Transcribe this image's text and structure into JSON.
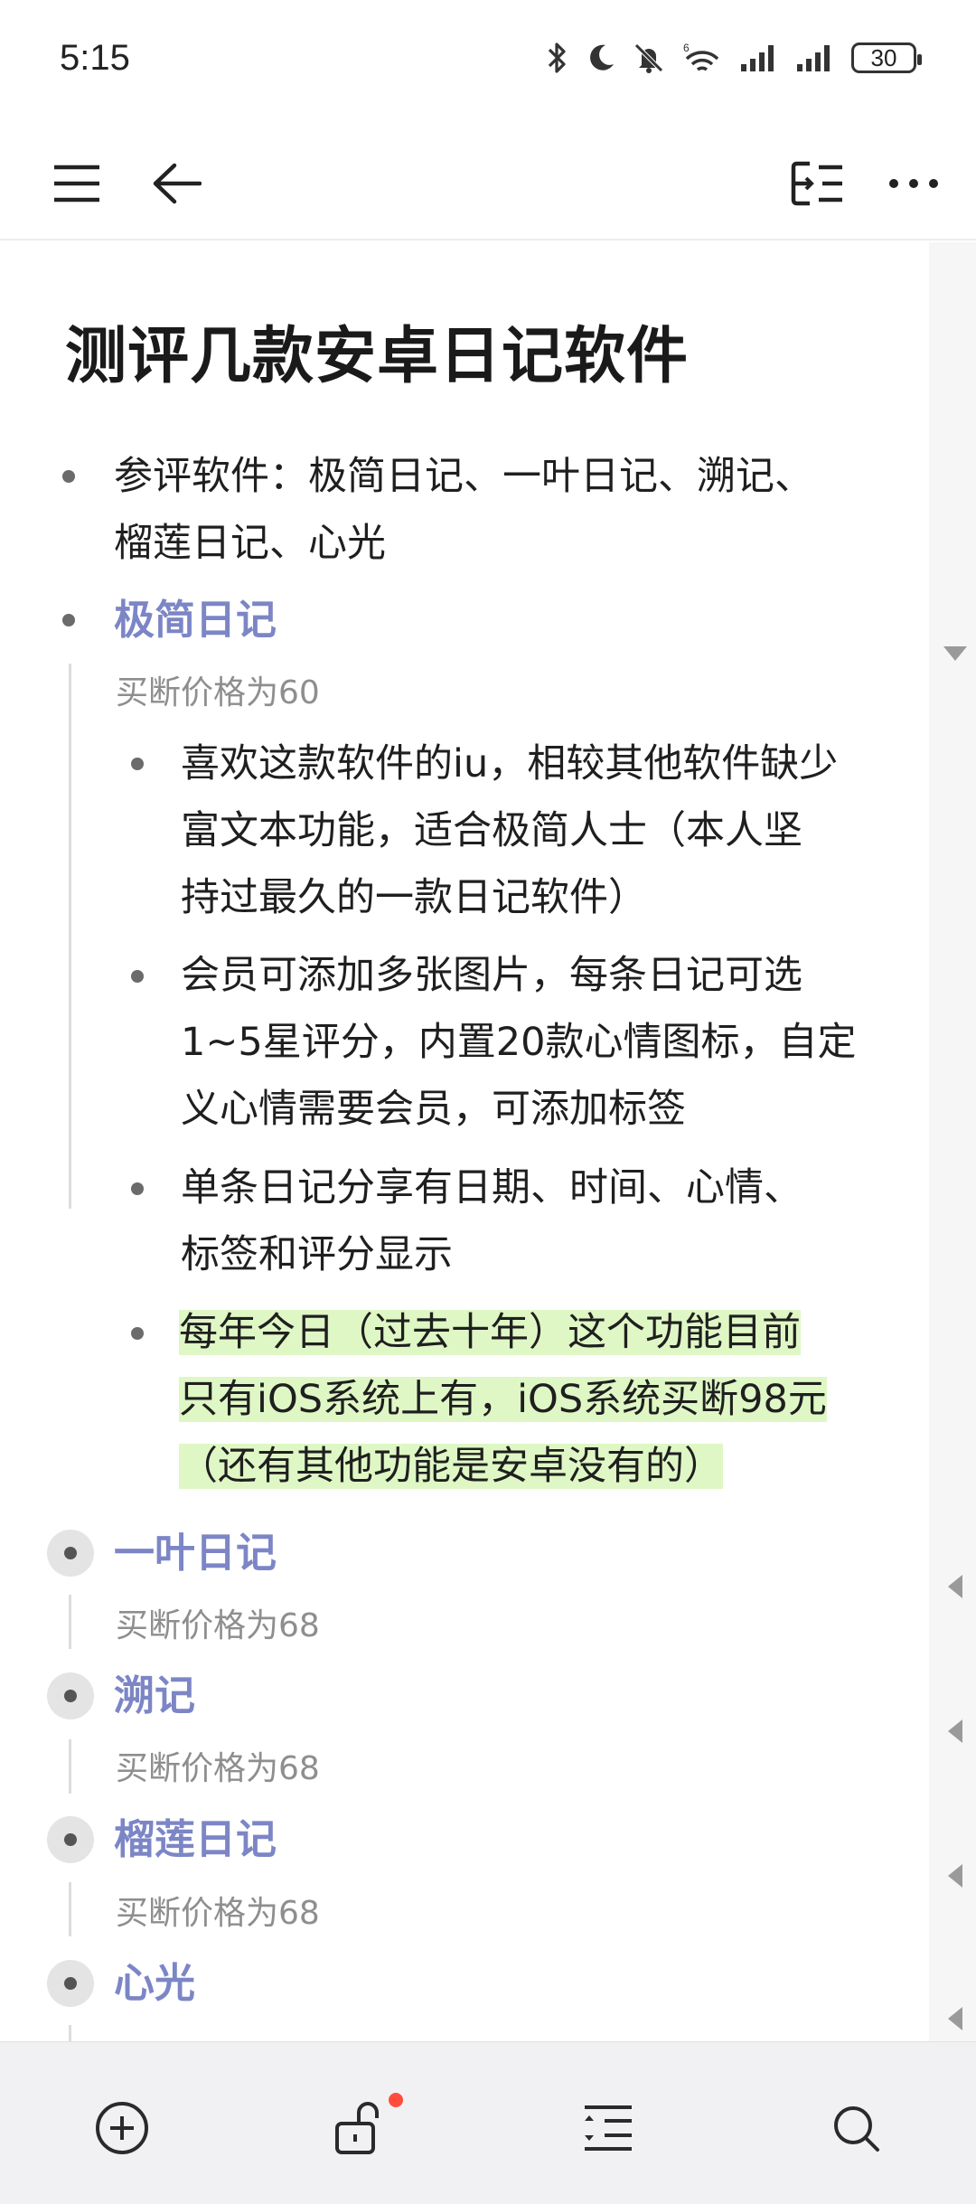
{
  "status_bar": {
    "time": "5:15",
    "battery": "30",
    "network_label": "6"
  },
  "toolbar": {
    "menu_icon": "menu-icon",
    "back_icon": "back-arrow-icon",
    "outline_icon": "outline-toggle-icon",
    "more_icon": "more-icon"
  },
  "document": {
    "title": "测评几款安卓日记软件",
    "intro_line1": "参评软件：极简日记、一叶日记、溯记、",
    "intro_line2": "榴莲日记、心光",
    "sections": [
      {
        "heading": "极简日记",
        "note": "买断价格为60",
        "items": [
          {
            "lines": [
              "喜欢这款软件的iu，相较其他软件缺少",
              "富文本功能，适合极简人士（本人坚",
              "持过最久的一款日记软件）"
            ]
          },
          {
            "lines": [
              "会员可添加多张图片，每条日记可选",
              "1~5星评分，内置20款心情图标，自定",
              "义心情需要会员，可添加标签"
            ]
          },
          {
            "lines": [
              "单条日记分享有日期、时间、心情、",
              "标签和评分显示"
            ]
          },
          {
            "lines": [
              "每年今日（过去十年）这个功能目前",
              "只有iOS系统上有，iOS系统买断98元",
              "（还有其他功能是安卓没有的）"
            ],
            "highlight": true
          }
        ]
      },
      {
        "heading": "一叶日记",
        "note": "买断价格为68"
      },
      {
        "heading": "溯记",
        "note": "买断价格为68"
      },
      {
        "heading": "榴莲日记",
        "note": "买断价格为68"
      },
      {
        "heading": "心光"
      }
    ]
  },
  "bottom_toolbar": {
    "add_icon": "add-circle-icon",
    "lock_icon": "unlock-icon",
    "format_icon": "indent-icon",
    "search_icon": "search-icon"
  },
  "colors": {
    "heading": "#7c86c6",
    "highlight": "#dff7c5",
    "note": "#8e8e8e"
  }
}
